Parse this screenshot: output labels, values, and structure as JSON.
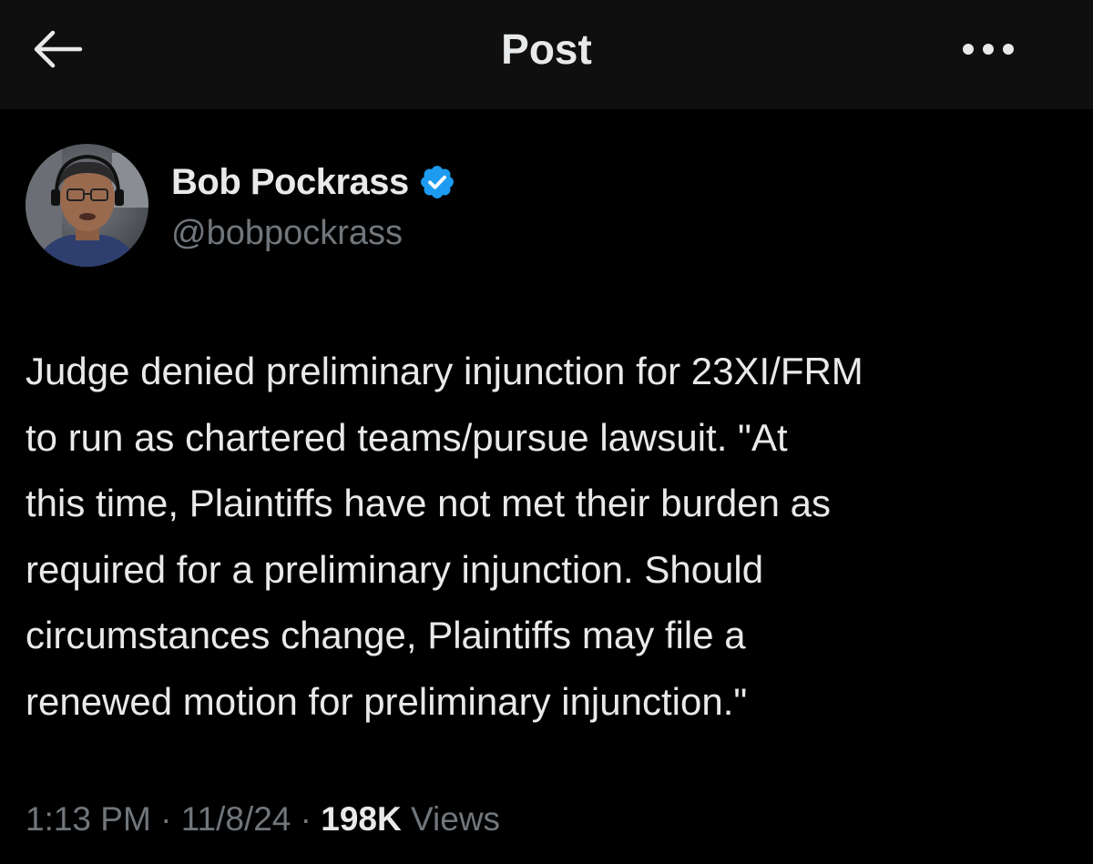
{
  "header": {
    "title": "Post",
    "back_icon": "arrow-left-icon",
    "more_icon": "more-horizontal-icon"
  },
  "author": {
    "name": "Bob Pockrass",
    "handle": "@bobpockrass",
    "verified_icon": "verified-badge-icon",
    "verified_color": "#1d9bf0"
  },
  "post": {
    "text": "Judge denied preliminary injunction for 23XI/FRM\nto run as chartered teams/pursue lawsuit. \"At\nthis time, Plaintiffs have not met their burden as\nrequired for a preliminary injunction. Should\ncircumstances change, Plaintiffs may file a\nrenewed motion for preliminary injunction.\""
  },
  "meta": {
    "time": "1:13 PM",
    "separator": "·",
    "date": "11/8/24",
    "views_count": "198K",
    "views_label": "Views"
  },
  "colors": {
    "background": "#000000",
    "header_background": "#0f0f0f",
    "text_primary": "#e7e9ea",
    "text_secondary": "#71767b"
  }
}
